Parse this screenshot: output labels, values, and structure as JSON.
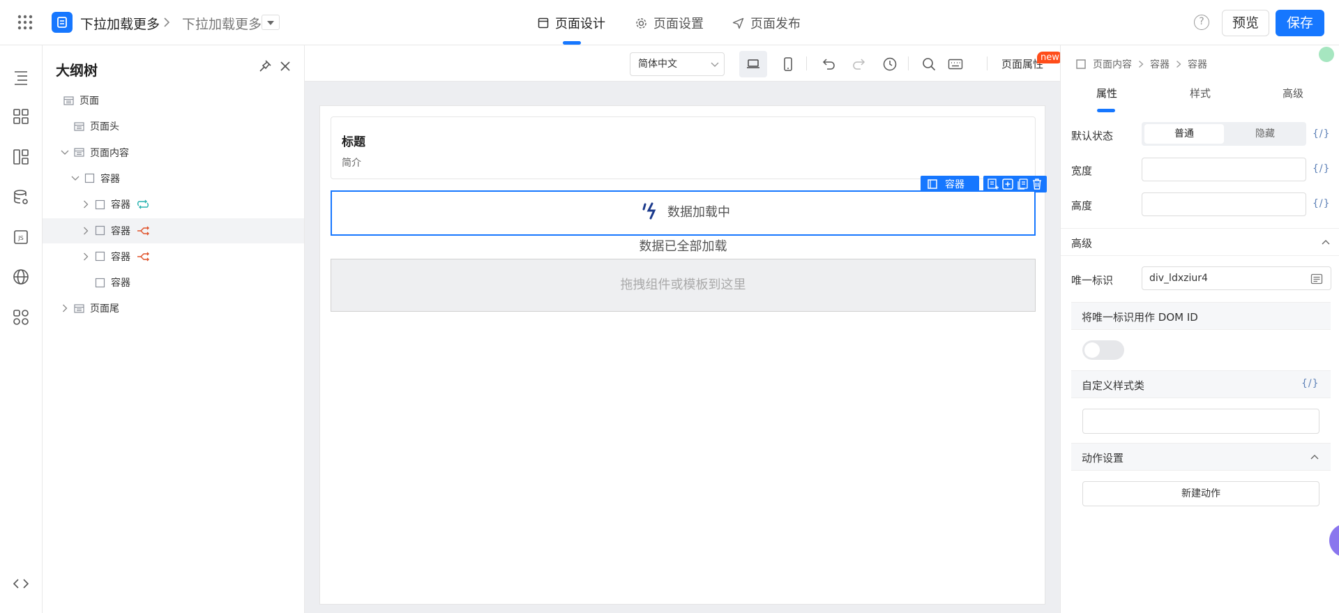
{
  "topbar": {
    "breadcrumb_app": "下拉加载更多",
    "breadcrumb_page": "下拉加载更多",
    "tabs": [
      {
        "label": "页面设计",
        "icon": "layout-icon",
        "active": true
      },
      {
        "label": "页面设置",
        "icon": "gear-icon",
        "active": false
      },
      {
        "label": "页面发布",
        "icon": "send-icon",
        "active": false
      }
    ],
    "help_label": "?",
    "preview_label": "预览",
    "save_label": "保存"
  },
  "outline": {
    "title": "大纲树",
    "items": [
      {
        "label": "页面",
        "depth": 0,
        "expanded": null,
        "icon": "page-icon"
      },
      {
        "label": "页面头",
        "depth": 1,
        "expanded": null,
        "icon": "page-icon"
      },
      {
        "label": "页面内容",
        "depth": 1,
        "expanded": true,
        "icon": "page-icon"
      },
      {
        "label": "容器",
        "depth": 2,
        "expanded": true,
        "icon": "container-icon"
      },
      {
        "label": "容器",
        "depth": 3,
        "expanded": false,
        "icon": "container-icon",
        "badge": "loop-icon"
      },
      {
        "label": "容器",
        "depth": 3,
        "expanded": false,
        "icon": "container-icon",
        "badge": "branch-icon",
        "selected": true
      },
      {
        "label": "容器",
        "depth": 3,
        "expanded": false,
        "icon": "container-icon",
        "badge": "branch-icon"
      },
      {
        "label": "容器",
        "depth": 3,
        "expanded": null,
        "icon": "container-icon"
      },
      {
        "label": "页面尾",
        "depth": 1,
        "expanded": false,
        "icon": "page-icon"
      }
    ]
  },
  "canvas_toolbar": {
    "language": "简体中文",
    "page_attr_label": "页面属性",
    "new_badge": "new"
  },
  "canvas": {
    "header_title": "标题",
    "header_subtitle": "简介",
    "selected_tag": "容器",
    "loading_text": "数据加载中",
    "loaded_all_text": "数据已全部加载",
    "dropzone_text": "拖拽组件或模板到这里"
  },
  "right_panel": {
    "crumbs": [
      "页面内容",
      "容器",
      "容器"
    ],
    "tabs": [
      "属性",
      "样式",
      "高级"
    ],
    "active_tab": "属性",
    "default_state_label": "默认状态",
    "state_options": [
      "普通",
      "隐藏"
    ],
    "width_label": "宽度",
    "height_label": "高度",
    "fx_label": "{/}",
    "advanced_label": "高级",
    "uid_label": "唯一标识",
    "uid_value": "div_ldxziur4",
    "dom_id_label": "将唯一标识用作 DOM ID",
    "dom_id_enabled": false,
    "custom_class_label": "自定义样式类",
    "actions_label": "动作设置",
    "new_action_label": "新建动作"
  },
  "colors": {
    "primary": "#1677ff",
    "new_badge": "#ff4d1a",
    "loop_badge": "#2ab3b0",
    "branch_badge": "#e0522a"
  }
}
